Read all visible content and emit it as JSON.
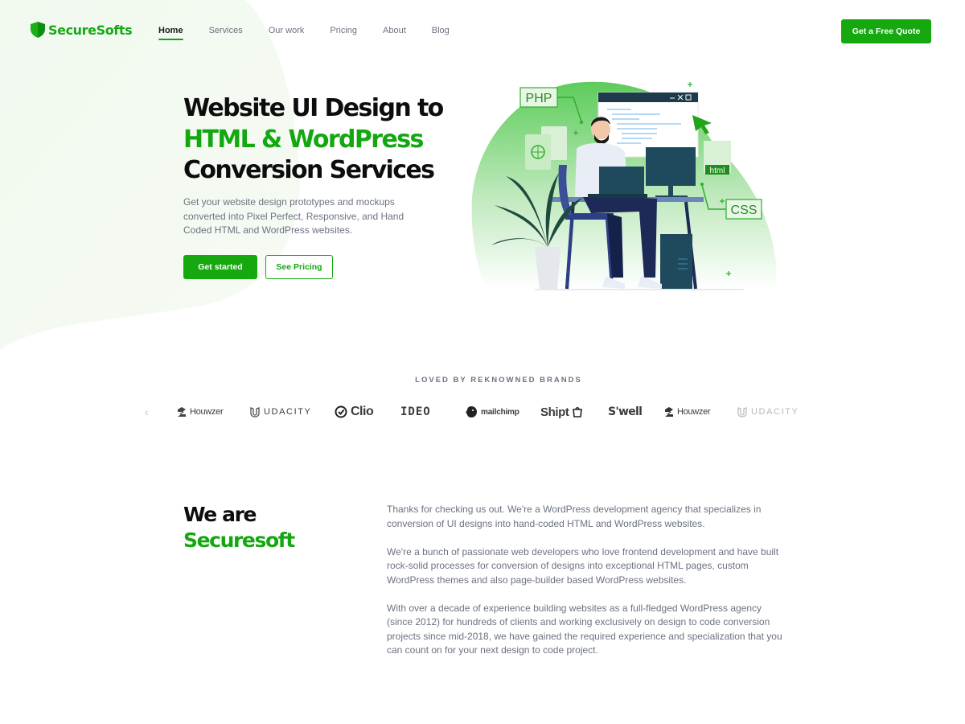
{
  "brand": {
    "name": "SecureSofts",
    "accent": "#15a80f",
    "text_dark": "#0d0d0d",
    "text_muted": "#6b7280"
  },
  "nav": {
    "items": [
      {
        "label": "Home",
        "active": true
      },
      {
        "label": "Services",
        "active": false
      },
      {
        "label": "Our work",
        "active": false
      },
      {
        "label": "Pricing",
        "active": false
      },
      {
        "label": "About",
        "active": false
      },
      {
        "label": "Blog",
        "active": false
      }
    ],
    "cta_label": "Get a Free Quote"
  },
  "hero": {
    "title_line1": "Website UI Design to",
    "title_line2": "HTML & WordPress",
    "title_line3": "Conversion Services",
    "description": "Get your website design prototypes and mockups converted into Pixel Perfect, Responsive, and Hand Coded HTML and WordPress websites.",
    "primary_button": "Get started",
    "secondary_button": "See Pricing",
    "illustration": {
      "icon": "developer-at-desk-illustration",
      "tags": [
        "PHP",
        "html",
        "CSS"
      ]
    }
  },
  "brands": {
    "heading": "LOVED BY REKNOWNED BRANDS",
    "logos": [
      {
        "name": "Houwzer",
        "icon": "houwzer-logo"
      },
      {
        "name": "UDACITY",
        "icon": "udacity-logo"
      },
      {
        "name": "Clio",
        "icon": "clio-logo"
      },
      {
        "name": "IDEO",
        "icon": "ideo-logo"
      },
      {
        "name": "mailchimp",
        "icon": "mailchimp-logo"
      },
      {
        "name": "Shipt",
        "icon": "shipt-logo"
      },
      {
        "name": "S'well",
        "icon": "swell-logo"
      },
      {
        "name": "Houwzer",
        "icon": "houwzer-logo"
      },
      {
        "name": "UDACITY",
        "icon": "udacity-logo"
      }
    ]
  },
  "about": {
    "title_line1": "We are",
    "title_line2": "Securesoft",
    "paragraphs": [
      "Thanks for checking us out. We're a WordPress development agency that specializes in conversion of UI designs into hand-coded HTML and WordPress websites.",
      "We're a bunch of passionate web developers who love frontend development and have built rock-solid processes for conversion of designs into exceptional HTML pages, custom WordPress themes and also page-builder based WordPress websites.",
      "With over a decade of experience building websites as a full-fledged WordPress agency (since 2012) for hundreds of clients and working exclusively on design to code conversion projects since mid-2018, we have gained the required experience and specialization that you can count on for your next design to code project."
    ]
  }
}
